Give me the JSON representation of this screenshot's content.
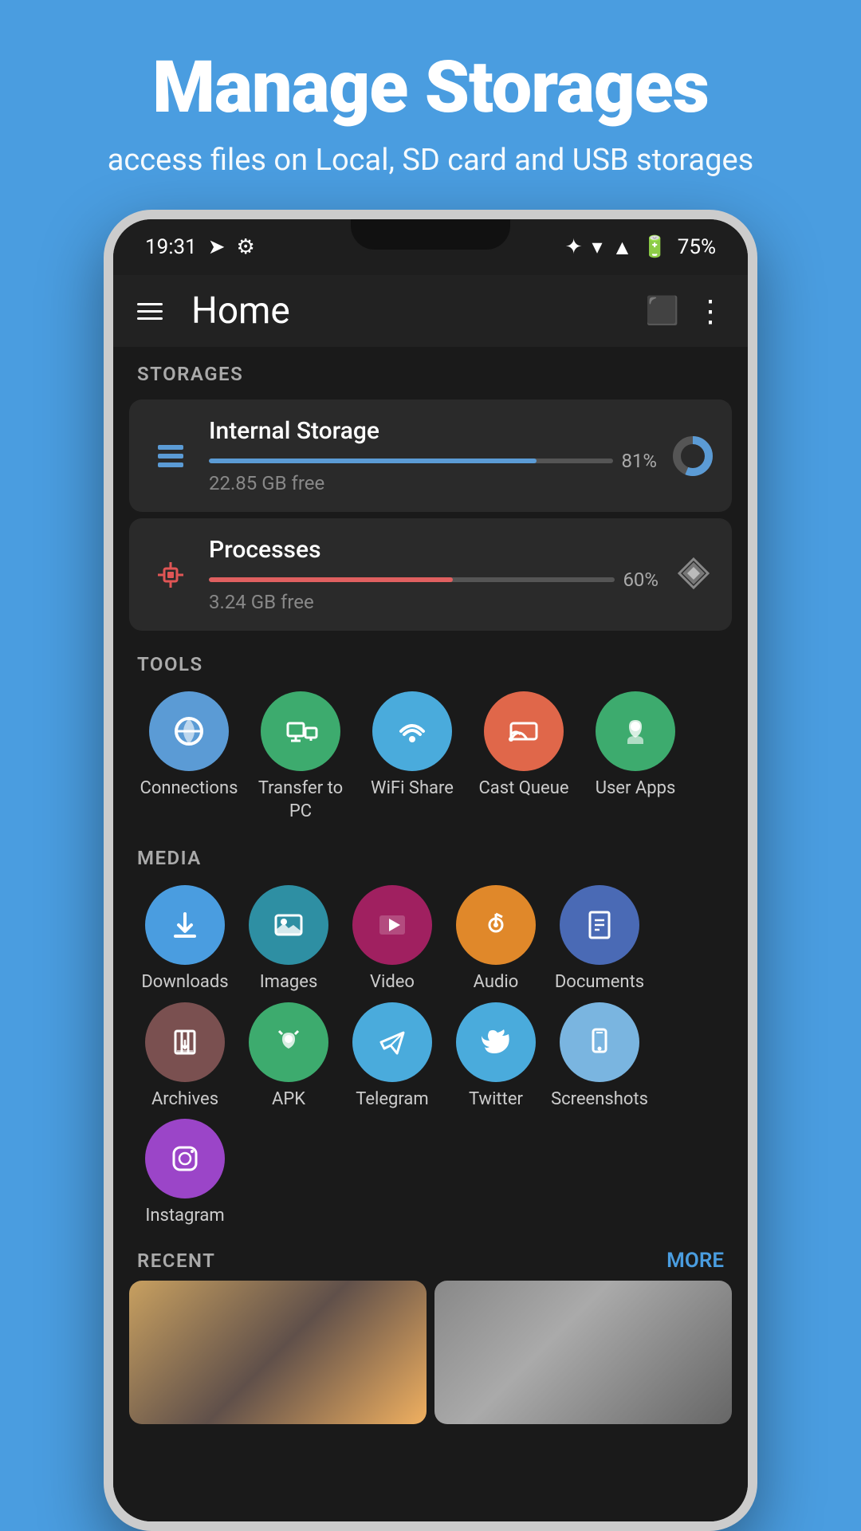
{
  "header": {
    "title": "Manage Storages",
    "subtitle": "access files on Local, SD card and USB storages"
  },
  "statusBar": {
    "time": "19:31",
    "battery": "75%"
  },
  "appBar": {
    "title": "Home"
  },
  "sections": {
    "storages": "STORAGES",
    "tools": "TOOLS",
    "media": "MEDIA",
    "recent": "RECENT",
    "more": "MORE"
  },
  "storageItems": [
    {
      "name": "Internal Storage",
      "percent": 81,
      "percentLabel": "81%",
      "free": "22.85 GB free"
    },
    {
      "name": "Processes",
      "percent": 60,
      "percentLabel": "60%",
      "free": "3.24 GB free"
    }
  ],
  "toolItems": [
    {
      "label": "Connections",
      "color": "#5b9bd5",
      "icon": "☁"
    },
    {
      "label": "Transfer to PC",
      "color": "#3dab6e",
      "icon": "🖥"
    },
    {
      "label": "WiFi Share",
      "color": "#4aabdc",
      "icon": "📶"
    },
    {
      "label": "Cast Queue",
      "color": "#e0674a",
      "icon": "📡"
    },
    {
      "label": "User Apps",
      "color": "#3dab6e",
      "icon": "🤖"
    }
  ],
  "mediaItems": [
    {
      "label": "Downloads",
      "color": "#4a9de0",
      "icon": "⬇"
    },
    {
      "label": "Images",
      "color": "#2e8fa3",
      "icon": "🖼"
    },
    {
      "label": "Video",
      "color": "#b03060",
      "icon": "🎬"
    },
    {
      "label": "Audio",
      "color": "#e0882a",
      "icon": "🎵"
    },
    {
      "label": "Documents",
      "color": "#4a6ab5",
      "icon": "📄"
    },
    {
      "label": "Archives",
      "color": "#7a5a5a",
      "icon": "⬇"
    },
    {
      "label": "APK",
      "color": "#3dab6e",
      "icon": "🤖"
    },
    {
      "label": "Telegram",
      "color": "#4aabdc",
      "icon": "✈"
    },
    {
      "label": "Twitter",
      "color": "#4aabdc",
      "icon": "🐦"
    },
    {
      "label": "Screenshots",
      "color": "#7ab5e0",
      "icon": "📱"
    },
    {
      "label": "Instagram",
      "color": "#9b45c8",
      "icon": "📷"
    }
  ]
}
